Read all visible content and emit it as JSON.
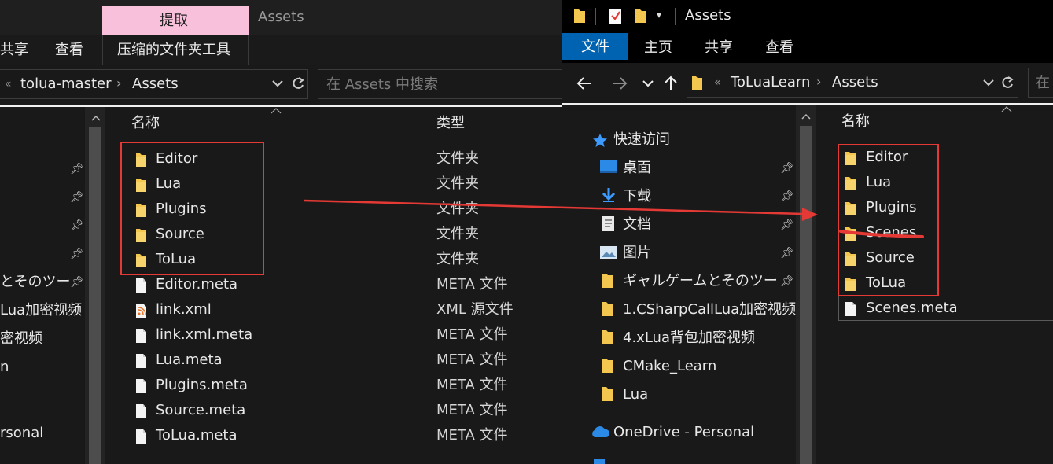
{
  "left": {
    "ribbon": {
      "context_tab": "提取",
      "title": "Assets",
      "tabs": [
        "共享",
        "查看",
        "压缩的文件夹工具"
      ]
    },
    "address": {
      "overflow": "«",
      "crumbs": [
        "tolua-master",
        "Assets"
      ],
      "search_placeholder": "在 Assets 中搜索"
    },
    "columns": {
      "name": "名称",
      "type": "类型"
    },
    "nav_items": [
      "とそのツー",
      "Lua加密视频",
      "密视频",
      "n",
      "rsonal"
    ],
    "files": [
      {
        "name": "Editor",
        "type": "文件夹",
        "icon": "folder-icon"
      },
      {
        "name": "Lua",
        "type": "文件夹",
        "icon": "folder-icon"
      },
      {
        "name": "Plugins",
        "type": "文件夹",
        "icon": "folder-icon"
      },
      {
        "name": "Source",
        "type": "文件夹",
        "icon": "folder-icon"
      },
      {
        "name": "ToLua",
        "type": "文件夹",
        "icon": "folder-icon"
      },
      {
        "name": "Editor.meta",
        "type": "META 文件",
        "icon": "file-icon"
      },
      {
        "name": "link.xml",
        "type": "XML 源文件",
        "icon": "xml-file-icon"
      },
      {
        "name": "link.xml.meta",
        "type": "META 文件",
        "icon": "file-icon"
      },
      {
        "name": "Lua.meta",
        "type": "META 文件",
        "icon": "file-icon"
      },
      {
        "name": "Plugins.meta",
        "type": "META 文件",
        "icon": "file-icon"
      },
      {
        "name": "Source.meta",
        "type": "META 文件",
        "icon": "file-icon"
      },
      {
        "name": "ToLua.meta",
        "type": "META 文件",
        "icon": "file-icon"
      }
    ]
  },
  "right": {
    "title": "Assets",
    "ribbon_tabs": [
      "文件",
      "主页",
      "共享",
      "查看"
    ],
    "address": {
      "overflow": "«",
      "crumbs": [
        "ToLuaLearn",
        "Assets"
      ],
      "search_placeholder": "在"
    },
    "columns": {
      "name": "名称"
    },
    "nav": {
      "quick_access": "快速访问",
      "items": [
        "桌面",
        "下载",
        "文档",
        "图片",
        "ギャルゲームとそのツー",
        "1.CSharpCallLua加密视频",
        "4.xLua背包加密视频",
        "CMake_Learn",
        "Lua"
      ],
      "onedrive": "OneDrive - Personal"
    },
    "files": [
      {
        "name": "Editor",
        "icon": "folder-icon"
      },
      {
        "name": "Lua",
        "icon": "folder-icon"
      },
      {
        "name": "Plugins",
        "icon": "folder-icon"
      },
      {
        "name": "Scenes",
        "icon": "folder-icon"
      },
      {
        "name": "Source",
        "icon": "folder-icon"
      },
      {
        "name": "ToLua",
        "icon": "folder-icon"
      },
      {
        "name": "Scenes.meta",
        "icon": "file-icon"
      }
    ]
  },
  "colors": {
    "accent": "#0063b1",
    "context_tab": "#f9c0dc",
    "annotation": "#e53935",
    "folder": "#f3c74f"
  }
}
